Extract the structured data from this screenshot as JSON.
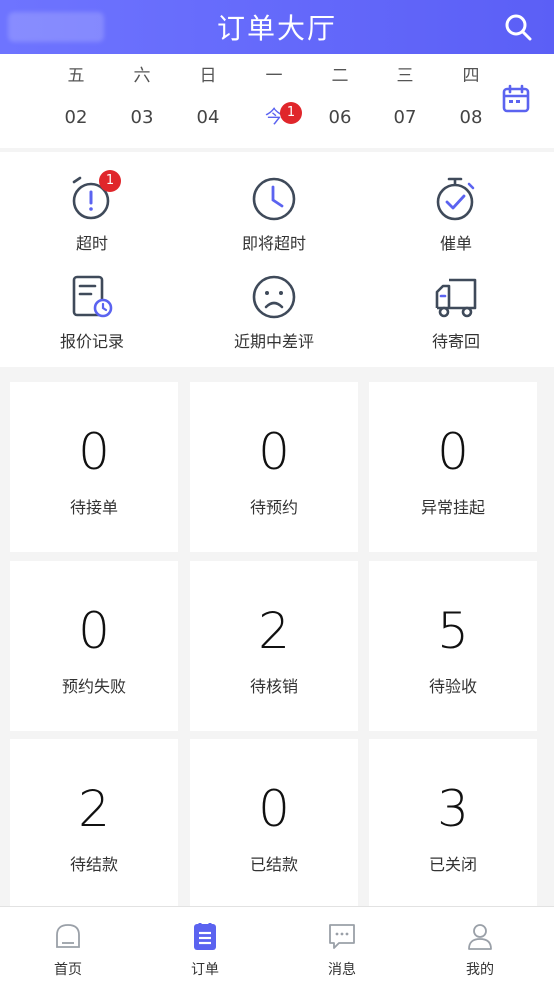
{
  "header": {
    "title": "订单大厅",
    "search_icon": "search-icon"
  },
  "datebar": {
    "days": [
      {
        "weekday": "五",
        "date": "02"
      },
      {
        "weekday": "六",
        "date": "03"
      },
      {
        "weekday": "日",
        "date": "04"
      },
      {
        "weekday": "一",
        "date": "今",
        "badge": "1"
      },
      {
        "weekday": "二",
        "date": "06"
      },
      {
        "weekday": "三",
        "date": "07"
      },
      {
        "weekday": "四",
        "date": "08"
      }
    ],
    "calendar_icon": "calendar-icon"
  },
  "quick": [
    {
      "label": "超时",
      "icon": "alarm-icon",
      "badge": "1"
    },
    {
      "label": "即将超时",
      "icon": "clock-icon"
    },
    {
      "label": "催单",
      "icon": "stopwatch-check-icon"
    },
    {
      "label": "报价记录",
      "icon": "quote-record-icon"
    },
    {
      "label": "近期中差评",
      "icon": "sad-face-icon"
    },
    {
      "label": "待寄回",
      "icon": "cart-icon"
    }
  ],
  "stats": [
    {
      "value": "0",
      "label": "待接单"
    },
    {
      "value": "0",
      "label": "待预约"
    },
    {
      "value": "0",
      "label": "异常挂起"
    },
    {
      "value": "0",
      "label": "预约失败"
    },
    {
      "value": "2",
      "label": "待核销"
    },
    {
      "value": "5",
      "label": "待验收"
    },
    {
      "value": "2",
      "label": "待结款"
    },
    {
      "value": "0",
      "label": "已结款"
    },
    {
      "value": "3",
      "label": "已关闭"
    }
  ],
  "tabbar": [
    {
      "label": "首页",
      "icon": "home-icon"
    },
    {
      "label": "订单",
      "icon": "order-icon",
      "active": true
    },
    {
      "label": "消息",
      "icon": "message-icon"
    },
    {
      "label": "我的",
      "icon": "user-icon"
    }
  ],
  "colors": {
    "accent": "#5b63f0",
    "badge": "#e0262b",
    "icon_stroke": "#3f4a5a"
  }
}
